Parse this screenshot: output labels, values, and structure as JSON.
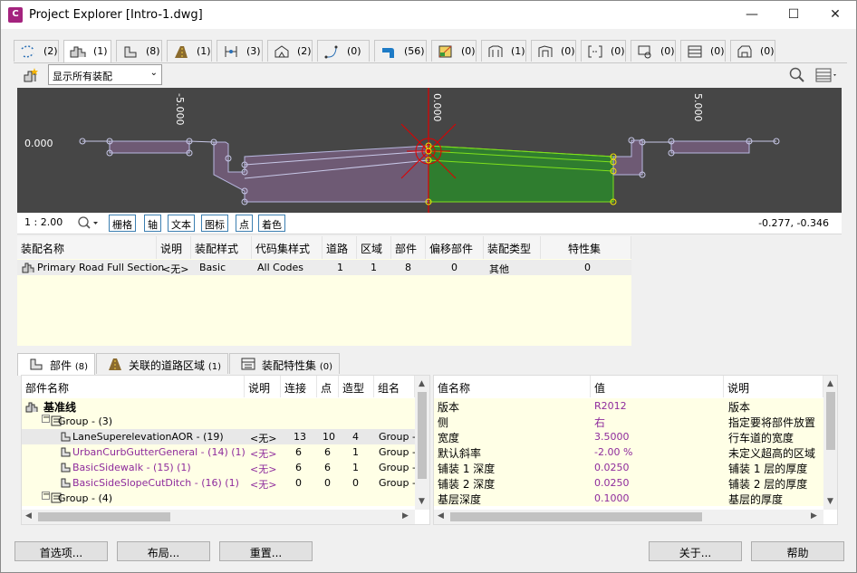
{
  "window": {
    "title": "Project Explorer [Intro-1.dwg]",
    "app_icon_letter": "C",
    "minimize": "—",
    "maximize": "☐",
    "close": "✕"
  },
  "toolbar_tabs": [
    {
      "count": "(2)",
      "icon": "alignment-icon"
    },
    {
      "count": "(1)",
      "icon": "assembly-icon"
    },
    {
      "count": "(8)",
      "icon": "subassembly-icon"
    },
    {
      "count": "(1)",
      "icon": "corridor-icon"
    },
    {
      "count": "(3)",
      "icon": "sample-line-icon"
    },
    {
      "count": "(2)",
      "icon": "surface-icon"
    },
    {
      "count": "(0)",
      "icon": "feature-line-icon"
    },
    {
      "count": "(56)",
      "icon": "pipe-icon"
    },
    {
      "count": "(0)",
      "icon": "point-group-icon"
    },
    {
      "count": "(1)",
      "icon": "profile-view-icon"
    },
    {
      "count": "(0)",
      "icon": "section-view-icon"
    },
    {
      "count": "(0)",
      "icon": "bracket-icon"
    },
    {
      "count": "(0)",
      "icon": "label-icon"
    },
    {
      "count": "(0)",
      "icon": "table-icon"
    },
    {
      "count": "(0)",
      "icon": "vehicle-icon"
    }
  ],
  "filter": {
    "selected": "显示所有装配"
  },
  "viewer": {
    "axis_labels": [
      "-5.000",
      "0.000",
      "5.000"
    ],
    "elevation_label": "0.000"
  },
  "viewer_bar": {
    "scale": "1 : 2.00",
    "tools": [
      "栅格",
      "轴",
      "文本",
      "图标",
      "点",
      "着色"
    ],
    "coords": "-0.277, -0.346"
  },
  "assembly_table": {
    "headers": [
      "装配名称",
      "说明",
      "装配样式",
      "代码集样式",
      "道路",
      "区域",
      "部件",
      "偏移部件",
      "装配类型",
      "特性集"
    ],
    "row": [
      "Primary Road Full Section",
      "<无>",
      "Basic",
      "All Codes",
      "1",
      "1",
      "8",
      "0",
      "其他",
      "0"
    ]
  },
  "bottom_tabs": [
    {
      "label": "部件",
      "count": "(8)"
    },
    {
      "label": "关联的道路区域",
      "count": "(1)"
    },
    {
      "label": "装配特性集",
      "count": "(0)"
    }
  ],
  "parts_table": {
    "headers": [
      "部件名称",
      "说明",
      "连接",
      "点",
      "造型",
      "组名"
    ],
    "rows": [
      {
        "name": "基准线",
        "desc": "",
        "links": "",
        "points": "",
        "shapes": "",
        "group": ""
      },
      {
        "name": "Group - (3)",
        "desc": "",
        "links": "",
        "points": "",
        "shapes": "",
        "group": ""
      },
      {
        "name": "LaneSuperelevationAOR - (19)",
        "desc": "<无>",
        "links": "13",
        "points": "10",
        "shapes": "4",
        "group": "Group -"
      },
      {
        "name": "UrbanCurbGutterGeneral - (14) (1)",
        "desc": "<无>",
        "links": "6",
        "points": "6",
        "shapes": "1",
        "group": "Group -"
      },
      {
        "name": "BasicSidewalk - (15) (1)",
        "desc": "<无>",
        "links": "6",
        "points": "6",
        "shapes": "1",
        "group": "Group -"
      },
      {
        "name": "BasicSideSlopeCutDitch - (16) (1)",
        "desc": "<无>",
        "links": "0",
        "points": "0",
        "shapes": "0",
        "group": "Group -"
      },
      {
        "name": "Group - (4)",
        "desc": "",
        "links": "",
        "points": "",
        "shapes": "",
        "group": ""
      }
    ]
  },
  "params_table": {
    "headers": [
      "值名称",
      "值",
      "说明"
    ],
    "rows": [
      {
        "name": "版本",
        "value": "R2012",
        "desc": "版本"
      },
      {
        "name": "侧",
        "value": "右",
        "desc": "指定要将部件放置"
      },
      {
        "name": "宽度",
        "value": "3.5000",
        "desc": "行车道的宽度"
      },
      {
        "name": "默认斜率",
        "value": "-2.00 %",
        "desc": "未定义超高的区域"
      },
      {
        "name": "铺装 1 深度",
        "value": "0.0250",
        "desc": "铺装 1 层的厚度"
      },
      {
        "name": "铺装 2 深度",
        "value": "0.0250",
        "desc": "铺装 2 层的厚度"
      },
      {
        "name": "基层深度",
        "value": "0.1000",
        "desc": "基层的厚度"
      }
    ]
  },
  "buttons": {
    "prefs": "首选项...",
    "layout": "布局...",
    "reset": "重置...",
    "about": "关于...",
    "help": "帮助"
  },
  "colors": {
    "accent_purple": "#8e2b9c",
    "viewer_bg": "#464646",
    "highlight_green": "#7fe01c",
    "selection_red": "#e00000",
    "yellow_row": "#ffffe6"
  }
}
